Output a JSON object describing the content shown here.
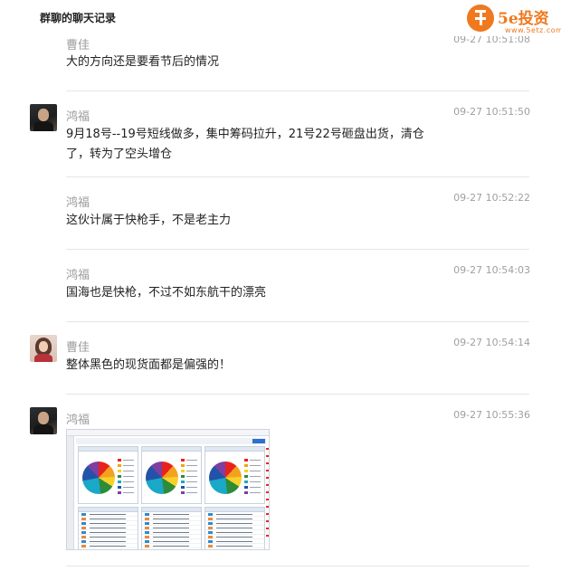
{
  "page": {
    "title": "群聊的聊天记录"
  },
  "logo": {
    "text": "5e投资",
    "url": "www.5etz.com",
    "color": "#f0781e"
  },
  "messages": [
    {
      "sender": "曹佳",
      "time": "09-27 10:51:08",
      "content": "大的方向还是要看节后的情况",
      "avatar": "none"
    },
    {
      "sender": "鸿福",
      "time": "09-27 10:51:50",
      "content": "9月18号--19号短线做多，集中筹码拉升，21号22号砸盘出货，清仓了，转为了空头增仓",
      "avatar": "man-photo"
    },
    {
      "sender": "鸿福",
      "time": "09-27 10:52:22",
      "content": "这伙计属于快枪手，不是老主力",
      "avatar": "none"
    },
    {
      "sender": "鸿福",
      "time": "09-27 10:54:03",
      "content": "国海也是快枪，不过不如东航干的漂亮",
      "avatar": "none"
    },
    {
      "sender": "曹佳",
      "time": "09-27 10:54:14",
      "content": "整体黑色的现货面都是偏强的！",
      "avatar": "woman-photo"
    },
    {
      "sender": "鸿福",
      "time": "09-27 10:55:36",
      "content": "",
      "avatar": "man-photo",
      "attachment": "screenshot-image"
    }
  ],
  "colors": {
    "divider": "#e6e6e6",
    "time": "#a0a0a0",
    "sender": "#9a9a9a",
    "text": "#222222"
  }
}
